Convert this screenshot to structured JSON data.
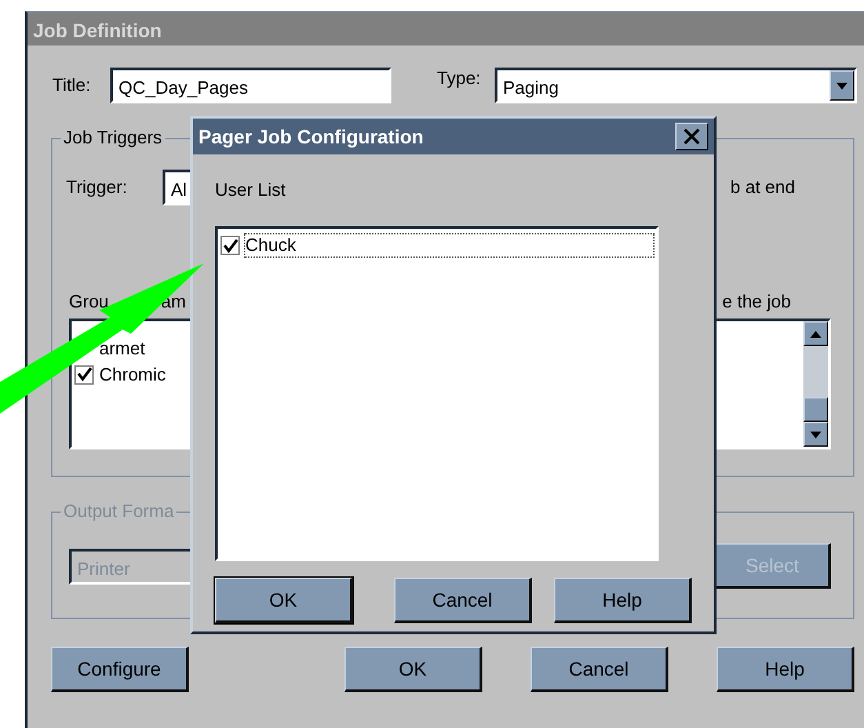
{
  "window": {
    "title": "Job Definition"
  },
  "header": {
    "title_label": "Title:",
    "title_value": "QC_Day_Pages",
    "type_label": "Type:",
    "type_value": "Paging"
  },
  "job_triggers": {
    "legend": "Job Triggers",
    "trigger_label": "Trigger:",
    "trigger_value": "Al",
    "right_note": "b at end",
    "group_label_parts": [
      "Grou",
      "am"
    ],
    "right_label": "e the job",
    "groups": [
      {
        "label": "armet"
      },
      {
        "label": "Chromic",
        "checked": true
      }
    ]
  },
  "output_format": {
    "legend": "Output Forma",
    "value": "Printer",
    "select_button": {
      "label": "Select",
      "disabled": true
    }
  },
  "buttons": [
    {
      "label": "Configure"
    },
    {
      "label": "OK"
    },
    {
      "label": "Cancel"
    },
    {
      "label": "Help"
    }
  ],
  "dialog": {
    "title": "Pager Job Configuration",
    "list_label": "User List",
    "users": [
      {
        "label": "Chuck",
        "checked": true,
        "selected": true
      }
    ],
    "buttons": [
      {
        "label": "OK",
        "default": true
      },
      {
        "label": "Cancel",
        "default": false
      },
      {
        "label": "Help",
        "default": false
      }
    ]
  }
}
